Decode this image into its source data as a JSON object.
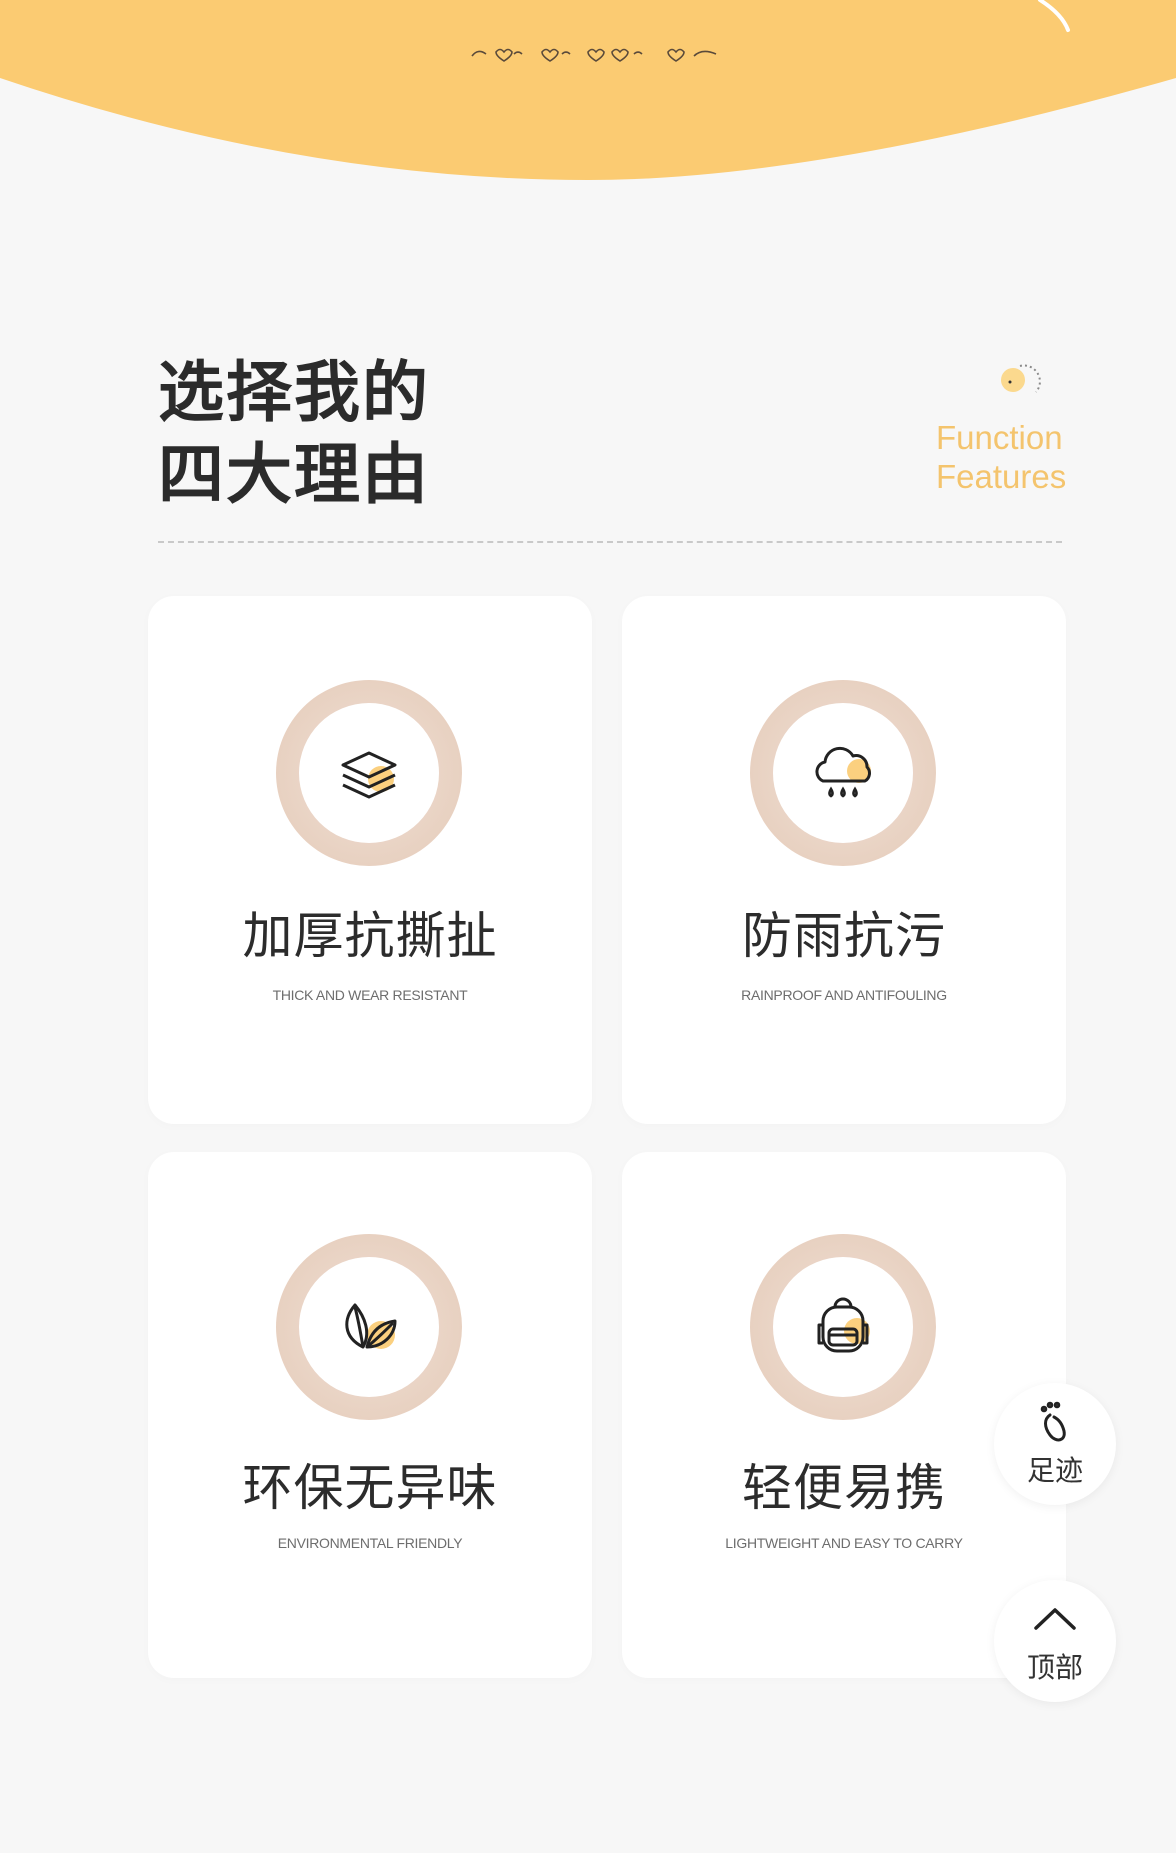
{
  "header": {
    "title_line1": "选择我的",
    "title_line2": "四大理由",
    "function_line1": "Function",
    "function_line2": "Features"
  },
  "features": [
    {
      "title": "加厚抗撕扯",
      "subtitle": "THICK AND WEAR RESISTANT",
      "icon": "layers-icon"
    },
    {
      "title": "防雨抗污",
      "subtitle": "RAINPROOF AND ANTIFOULING",
      "icon": "rain-cloud-icon"
    },
    {
      "title": "环保无异味",
      "subtitle": "ENVIRONMENTAL FRIENDLY",
      "icon": "leaf-icon"
    },
    {
      "title": "轻便易携",
      "subtitle": "LIGHTWEIGHT AND EASY TO CARRY",
      "icon": "backpack-icon"
    }
  ],
  "floating": {
    "footprint_label": "足迹",
    "top_label": "顶部"
  },
  "colors": {
    "accent_yellow": "#fbcb72",
    "function_text": "#f4c46d",
    "ring": "#e8d1c1"
  }
}
